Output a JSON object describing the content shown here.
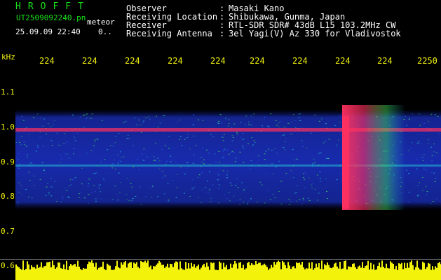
{
  "header": {
    "brand": "HROFFT",
    "filename": "UT2509092240.pn",
    "sub_tag": "meteor",
    "timestamp": "25.09.09 22:40",
    "timestamp_extra": "0.."
  },
  "station_info": [
    {
      "label": "Observer",
      "value": "Masaki Kano"
    },
    {
      "label": "Receiving Location",
      "value": "Shibukawa, Gunma, Japan"
    },
    {
      "label": "Receiver",
      "value": "RTL-SDR SDR# 43dB L15 103.2MHz CW"
    },
    {
      "label": "Receiving Antenna",
      "value": "3el Yagi(V) Az 330 for Vladivostok"
    }
  ],
  "colon": ":",
  "x_axis": {
    "tick_labels": [
      "224",
      "224",
      "224",
      "224",
      "224",
      "224",
      "224",
      "224",
      "224",
      "2250"
    ]
  },
  "y_axis": {
    "unit": "kHz",
    "tick_labels": [
      "1.1",
      "1.0",
      "0.9",
      "0.8",
      "0.7",
      "0.6"
    ]
  },
  "colors": {
    "label_green": "#19e419",
    "text_white": "#ffffff",
    "axis_yellow": "#f2f20a",
    "background": "#000000",
    "noise_blue": "#1a2fbf",
    "signal_red": "#ff3060",
    "mid_cyan": "#22c8d8",
    "mid_green": "#3ee050"
  }
}
